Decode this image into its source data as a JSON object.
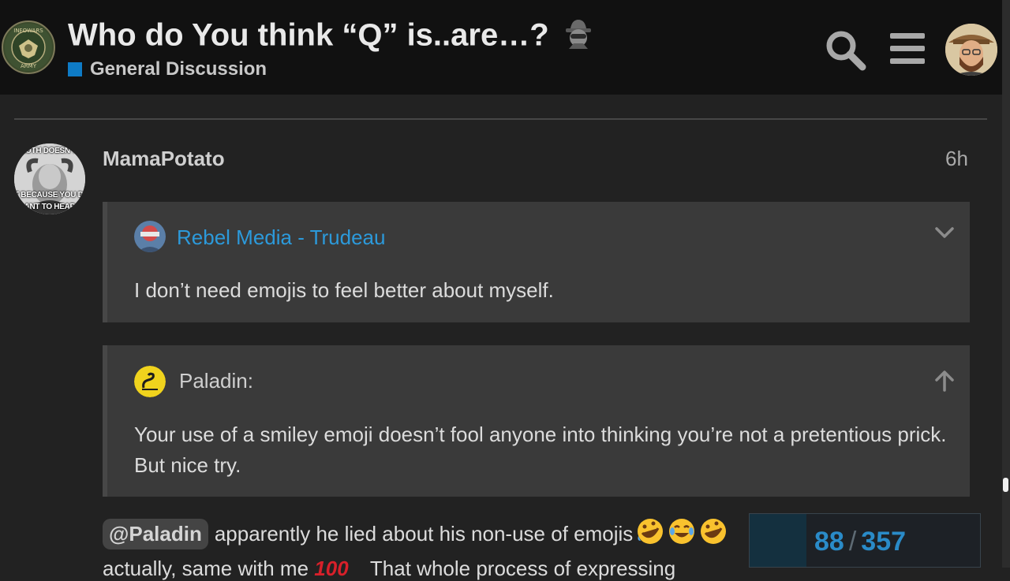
{
  "header": {
    "title": "Who do You think “Q” is..are…?",
    "title_emoji": "spy-icon",
    "category": "General Discussion",
    "category_color": "#0e7bc6",
    "logo_icon": "infowars-army-logo",
    "search_icon": "search-icon",
    "menu_icon": "hamburger-menu-icon"
  },
  "post": {
    "username": "MamaPotato",
    "time": "6h",
    "avatar_text_top": "TRUTH DOESN'T C",
    "avatar_text_bottom": "T BECAUSE YOU DO",
    "avatar_text_bottom2": "ANT TO HEAR",
    "quotes": [
      {
        "source_link": "Rebel Media - Trudeau",
        "text": "I don’t need emojis to feel better about myself.",
        "control_icon": "chevron-down-icon"
      },
      {
        "author": "Paladin:",
        "text": "Your use of a smiley emoji doesn’t fool anyone into thinking you’re not a pretentious prick. But nice try.",
        "control_icon": "arrow-up-icon"
      }
    ],
    "reply": {
      "mention": "@Paladin",
      "text": "apparently he lied about his non-use of emojis",
      "emojis": [
        "rofl-icon",
        "joy-icon",
        "rofl-icon"
      ],
      "second_line_start": "actually, same with me",
      "hundred": "100",
      "second_line_end": "That whole process of expressing"
    }
  },
  "progress": {
    "current": "88",
    "total": "357",
    "fraction": 0.2465,
    "accent": "#2a8bc8"
  }
}
